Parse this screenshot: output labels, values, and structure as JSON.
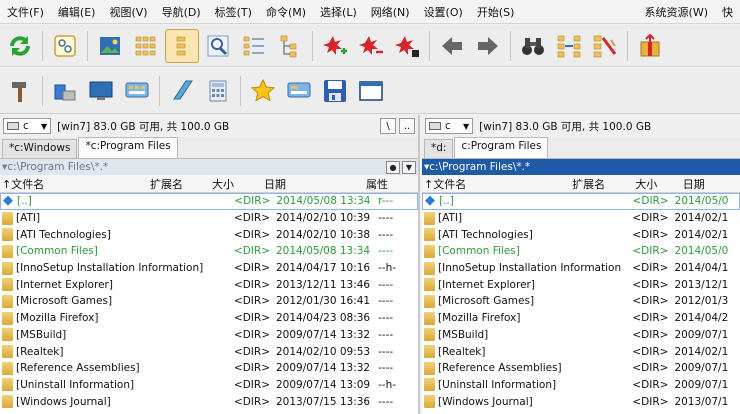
{
  "menu": [
    "文件(F)",
    "编辑(E)",
    "视图(V)",
    "导航(D)",
    "标签(T)",
    "命令(M)",
    "选择(L)",
    "网络(N)",
    "设置(O)",
    "开始(S)"
  ],
  "menu_right": [
    "系统资源(W)",
    "快"
  ],
  "toolbar1_icons": [
    "refresh-icon",
    "tree-view-icon",
    "thumbnail-view-icon",
    "grid-view-icon",
    "list-view-icon",
    "search-view-icon",
    "detail-view-icon",
    "branch-view-icon",
    "select-add-icon",
    "select-remove-icon",
    "invert-selection-icon",
    "back-arrow-icon",
    "forward-arrow-icon",
    "binoculars-icon",
    "compare-icon",
    "sync-icon",
    "pack-icon"
  ],
  "toolbar2_icons": [
    "hammer-icon",
    "computer-icon",
    "monitor-icon",
    "network-icon",
    "notepad-icon",
    "calculator-icon",
    "favorites-star-icon",
    "network-drive-icon",
    "save-disk-icon",
    "window-icon"
  ],
  "left": {
    "drive": "c",
    "drive_info": "[win7]  83.0 GB 可用, 共 100.0 GB",
    "nav_buttons": [
      "\\",
      ".."
    ],
    "tabs": [
      "*c:Windows",
      "*c:Program Files"
    ],
    "path": "▾c:\\Program Files\\*.*",
    "columns": [
      "↑文件名",
      "扩展名",
      "大小",
      "日期",
      "属性"
    ],
    "rows": [
      {
        "name": "[..]",
        "size": "<DIR>",
        "date": "2014/05/08 13:34",
        "attr": "r---",
        "green": true,
        "up": true
      },
      {
        "name": "[ATI]",
        "size": "<DIR>",
        "date": "2014/02/10 10:39",
        "attr": "----"
      },
      {
        "name": "[ATI Technologies]",
        "size": "<DIR>",
        "date": "2014/02/10 10:38",
        "attr": "----"
      },
      {
        "name": "[Common Files]",
        "size": "<DIR>",
        "date": "2014/05/08 13:34",
        "attr": "----",
        "green": true
      },
      {
        "name": "[InnoSetup Installation Information]",
        "size": "<DIR>",
        "date": "2014/04/17 10:16",
        "attr": "--h-"
      },
      {
        "name": "[Internet Explorer]",
        "size": "<DIR>",
        "date": "2013/12/11 13:46",
        "attr": "----"
      },
      {
        "name": "[Microsoft Games]",
        "size": "<DIR>",
        "date": "2012/01/30 16:41",
        "attr": "----"
      },
      {
        "name": "[Mozilla Firefox]",
        "size": "<DIR>",
        "date": "2014/04/23 08:36",
        "attr": "----"
      },
      {
        "name": "[MSBuild]",
        "size": "<DIR>",
        "date": "2009/07/14 13:32",
        "attr": "----"
      },
      {
        "name": "[Realtek]",
        "size": "<DIR>",
        "date": "2014/02/10 09:53",
        "attr": "----"
      },
      {
        "name": "[Reference Assemblies]",
        "size": "<DIR>",
        "date": "2009/07/14 13:32",
        "attr": "----"
      },
      {
        "name": "[Uninstall Information]",
        "size": "<DIR>",
        "date": "2009/07/14 13:09",
        "attr": "--h-"
      },
      {
        "name": "[Windows Journal]",
        "size": "<DIR>",
        "date": "2013/07/15 13:36",
        "attr": "----"
      }
    ]
  },
  "right": {
    "drive": "c",
    "drive_info": "[win7]  83.0 GB 可用, 共 100.0 GB",
    "tabs": [
      "*d:",
      "c:Program Files"
    ],
    "path": "▾c:\\Program Files\\*.*",
    "columns": [
      "↑文件名",
      "扩展名",
      "大小",
      "日期"
    ],
    "rows": [
      {
        "name": "[..]",
        "size": "<DIR>",
        "date": "2014/05/0",
        "green": true,
        "up": true
      },
      {
        "name": "[ATI]",
        "size": "<DIR>",
        "date": "2014/02/1"
      },
      {
        "name": "[ATI Technologies]",
        "size": "<DIR>",
        "date": "2014/02/1"
      },
      {
        "name": "[Common Files]",
        "size": "<DIR>",
        "date": "2014/05/0",
        "green": true
      },
      {
        "name": "[InnoSetup Installation Information]",
        "size": "<DIR>",
        "date": "2014/04/1"
      },
      {
        "name": "[Internet Explorer]",
        "size": "<DIR>",
        "date": "2013/12/1"
      },
      {
        "name": "[Microsoft Games]",
        "size": "<DIR>",
        "date": "2012/01/3"
      },
      {
        "name": "[Mozilla Firefox]",
        "size": "<DIR>",
        "date": "2014/04/2"
      },
      {
        "name": "[MSBuild]",
        "size": "<DIR>",
        "date": "2009/07/1"
      },
      {
        "name": "[Realtek]",
        "size": "<DIR>",
        "date": "2014/02/1"
      },
      {
        "name": "[Reference Assemblies]",
        "size": "<DIR>",
        "date": "2009/07/1"
      },
      {
        "name": "[Uninstall Information]",
        "size": "<DIR>",
        "date": "2009/07/1"
      },
      {
        "name": "[Windows Journal]",
        "size": "<DIR>",
        "date": "2013/07/1"
      }
    ]
  }
}
